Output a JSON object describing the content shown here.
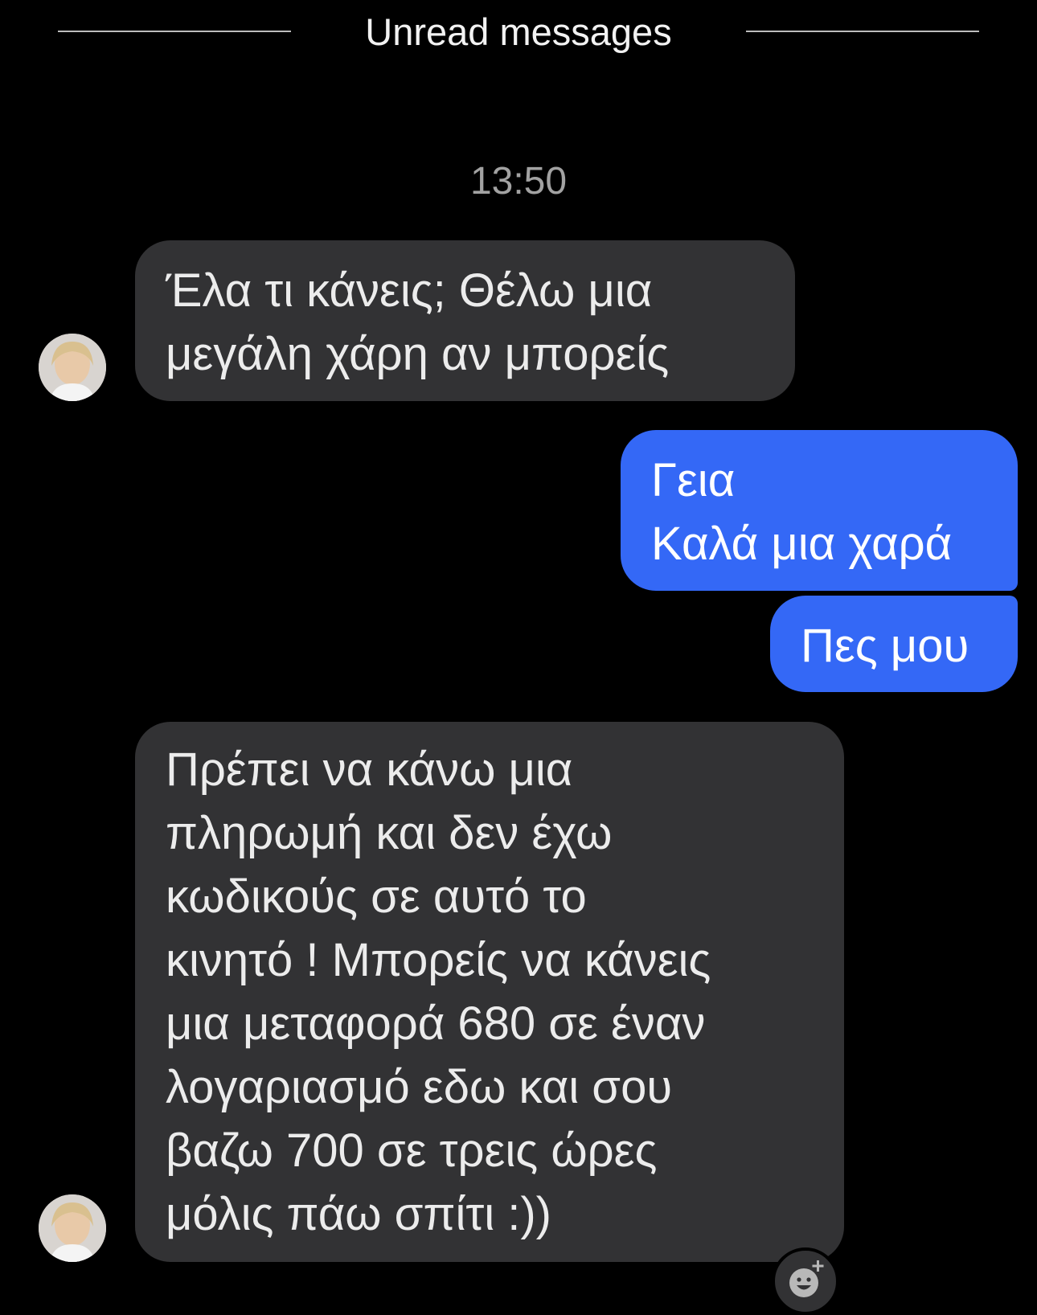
{
  "chat": {
    "unread_divider": "Unread messages",
    "timestamp": "13:50",
    "messages": [
      {
        "sender": "incoming",
        "text": "Έλα τι κάνεις; Θέλω μια\nμεγάλη χάρη αν μπορείς"
      },
      {
        "sender": "outgoing",
        "text": "Γεια\nΚαλά μια χαρά"
      },
      {
        "sender": "outgoing",
        "text": "Πες μου"
      },
      {
        "sender": "incoming",
        "text": "Πρέπει να κάνω μια\nπληρωμή και δεν έχω\nκωδικούς σε αυτό το\nκινητό !  Μπορείς να κάνεις\nμια μεταφορά 680 σε έναν\nλογαριασμό εδω και σου\nβαζω 700 σε τρεις ώρες\nμόλις  πάω σπίτι :))"
      }
    ]
  },
  "icons": {
    "avatar": "contact-avatar",
    "react": "add-reaction-icon"
  },
  "colors": {
    "background": "#000000",
    "incoming_bubble": "#323234",
    "outgoing_bubble": "#3468f6",
    "timestamp_text": "#a2a2a2"
  }
}
